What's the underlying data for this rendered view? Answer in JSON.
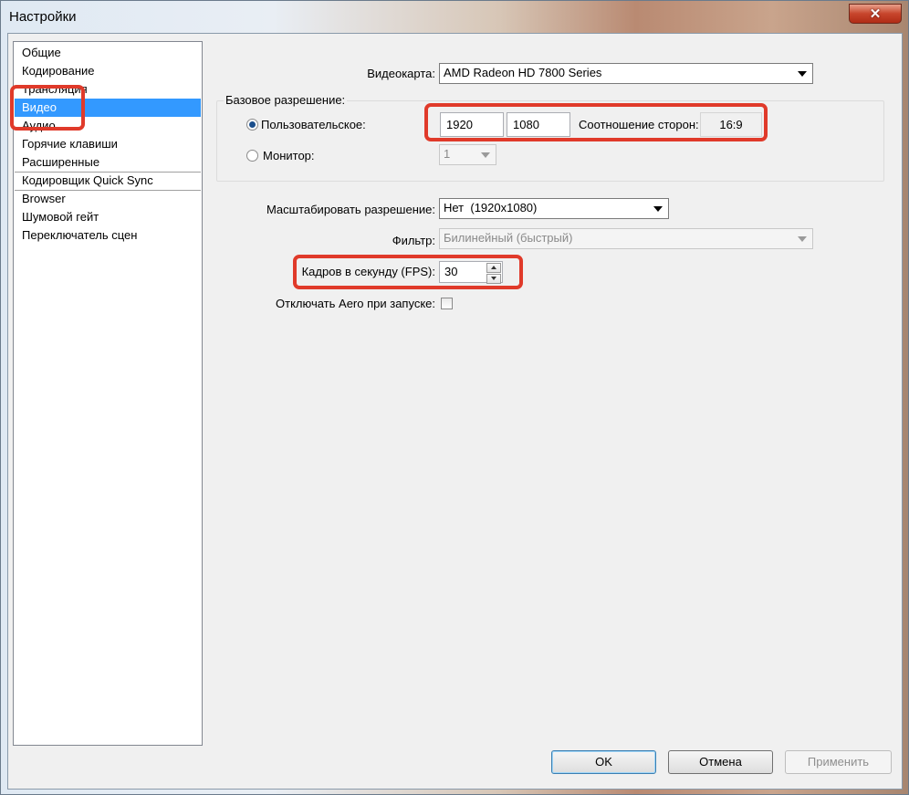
{
  "window": {
    "title": "Настройки",
    "close_glyph": "✕"
  },
  "sidebar": {
    "items": [
      {
        "label": "Общие"
      },
      {
        "label": "Кодирование"
      },
      {
        "label": "Трансляция"
      },
      {
        "label": "Видео",
        "selected": true
      },
      {
        "label": "Аудио"
      },
      {
        "label": "Горячие клавиши"
      },
      {
        "label": "Расширенные"
      },
      {
        "label": "Кодировщик Quick Sync"
      },
      {
        "label": "Browser"
      },
      {
        "label": "Шумовой гейт"
      },
      {
        "label": "Переключатель сцен"
      }
    ]
  },
  "video": {
    "gpu_label": "Видеокарта:",
    "gpu_value": "AMD Radeon HD 7800 Series",
    "base_group_label": "Базовое разрешение:",
    "custom_label": "Пользовательское:",
    "width": "1920",
    "height": "1080",
    "aspect_label": "Соотношение сторон:",
    "aspect_value": "16:9",
    "monitor_label": "Монитор:",
    "monitor_value": "1",
    "scale_label": "Масштабировать разрешение:",
    "scale_value": "Нет  (1920x1080)",
    "filter_label": "Фильтр:",
    "filter_value": "Билинейный (быстрый)",
    "fps_label": "Кадров в секунду (FPS):",
    "fps_value": "30",
    "aero_label": "Отключать Aero при запуске:"
  },
  "buttons": {
    "ok": "OK",
    "cancel": "Отмена",
    "apply": "Применить"
  },
  "colors": {
    "selection": "#3399ff",
    "highlight": "#e03a2a"
  }
}
